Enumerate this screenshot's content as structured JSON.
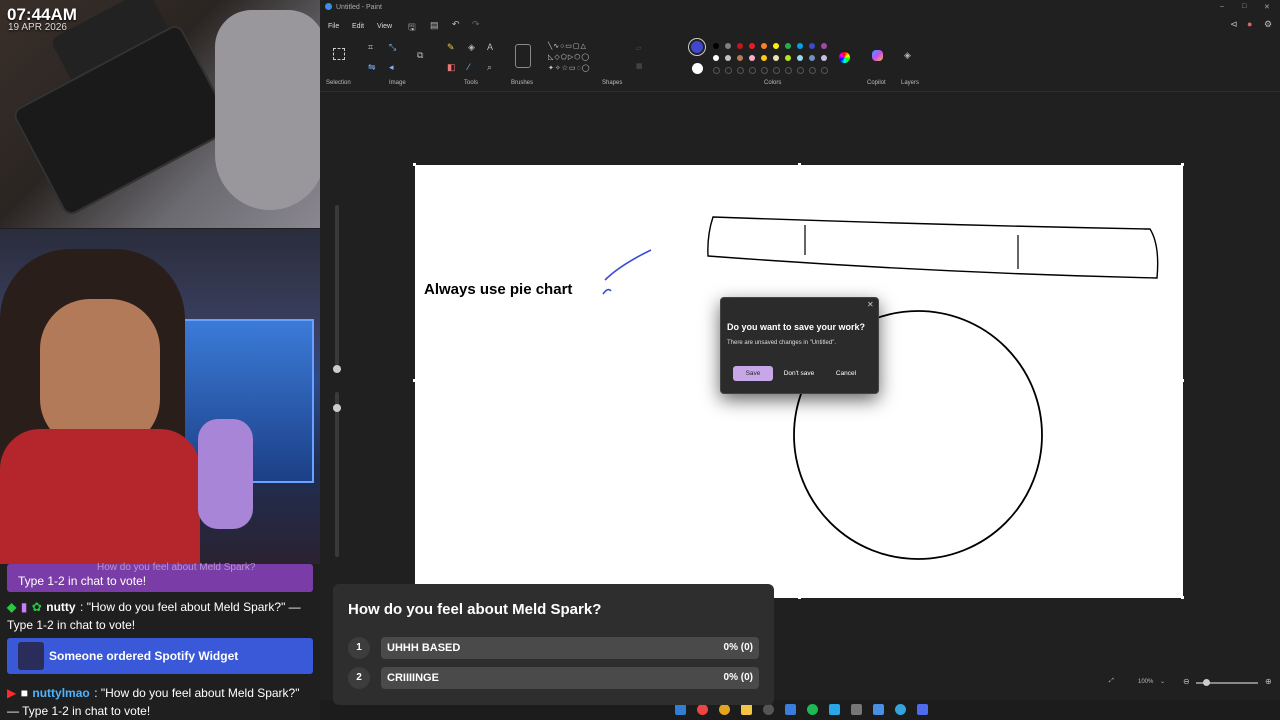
{
  "stream": {
    "clock": "07:44AM",
    "date": "19 APR 2026"
  },
  "chat": {
    "ghost_line": "How do you feel about Meld Spark?",
    "vote_line_1": "Type 1-2 in chat to vote!",
    "line2_user": "nutty",
    "line2_msg": ": \"How do you feel about Meld Spark?\" — Type 1-2 in chat to vote!",
    "spotify_alert": "Someone ordered Spotify Widget",
    "line3_user": "nuttylmao",
    "line3_msg": ": \"How do you feel about Meld Spark?\" — Type 1-2 in chat to vote!"
  },
  "paint": {
    "window_title": "Untitled - Paint",
    "menu": [
      "File",
      "Edit",
      "View"
    ],
    "groups": {
      "selection": "Selection",
      "image": "Image",
      "tools": "Tools",
      "brushes": "Brushes",
      "shapes": "Shapes",
      "colors": "Colors",
      "copilot": "Copilot",
      "layers": "Layers"
    },
    "palette_row1": [
      "#000000",
      "#7f7f7f",
      "#c3161c",
      "#ec1c24",
      "#ff7f27",
      "#fff200",
      "#22b14c",
      "#00a2e8",
      "#3f48cc",
      "#a349a4"
    ],
    "palette_row2": [
      "#ffffff",
      "#c3c3c3",
      "#b97a57",
      "#ffaec9",
      "#ffc90e",
      "#efe4b0",
      "#b5e61d",
      "#99d9ea",
      "#7092be",
      "#c8bfe7"
    ],
    "active_color": "#3f48cc",
    "canvas_text": "Always use pie chart",
    "zoom": "100%"
  },
  "dialog": {
    "title": "Do you want to save your work?",
    "subtitle": "There are unsaved changes in \"Untitled\".",
    "save": "Save",
    "dont_save": "Don't save",
    "cancel": "Cancel"
  },
  "poll": {
    "question": "How do you feel about Meld Spark?",
    "options": [
      {
        "num": "1",
        "label": "UHHH BASED",
        "result": "0% (0)",
        "share": 0
      },
      {
        "num": "2",
        "label": "CRIIIINGE",
        "result": "0% (0)",
        "share": 0
      }
    ]
  }
}
